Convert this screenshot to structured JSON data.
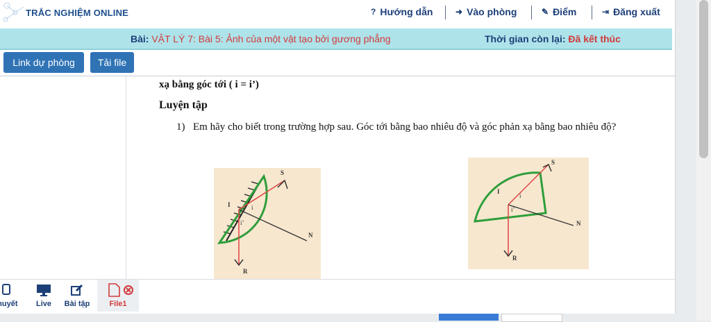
{
  "header": {
    "brand": "TRẮC NGHIỆM ONLINE",
    "nav": [
      {
        "icon": "question-icon",
        "glyph": "?",
        "label": "Hướng dẫn"
      },
      {
        "icon": "login-icon",
        "glyph": "➜",
        "label": "Vào phòng"
      },
      {
        "icon": "edit-icon",
        "glyph": "✎",
        "label": "Điểm"
      },
      {
        "icon": "logout-icon",
        "glyph": "⇥",
        "label": "Đăng xuất"
      }
    ]
  },
  "lesson": {
    "prefix": "Bài:",
    "title": "VẬT LÝ 7: Bài 5: Ảnh của một vật tạo bởi gương phẳng",
    "time_label": "Thời gian còn lại:",
    "time_value": "Đã kết thúc"
  },
  "actions": {
    "backup_link": "Link dự phòng",
    "download": "Tải file"
  },
  "content": {
    "line1": "xạ bằng góc tới ( i = i’)",
    "section": "Luyện tập",
    "question_num": "1)",
    "question_text": "Em hãy cho biết trong trường hợp sau. Góc tới bằng bao nhiêu độ và góc phản xạ bằng bao nhiêu độ?",
    "figure1_labels": {
      "s": "S",
      "i_point": "I",
      "i": "i",
      "i_prime": "i’",
      "n": "N",
      "r": "R"
    },
    "figure2_labels": {
      "s": "S",
      "i_point": "I",
      "i": "i",
      "i_prime": "i’",
      "n": "N",
      "r": "R"
    }
  },
  "bottom_tabs": [
    {
      "label": "thuyết",
      "icon": "tablet-icon"
    },
    {
      "label": "Live",
      "icon": "monitor-icon"
    },
    {
      "label": "Bài tập",
      "icon": "edit-icon"
    },
    {
      "label": "File1",
      "icon": "file-icon",
      "active": true
    }
  ],
  "colors": {
    "accent": "#2f73b5",
    "danger": "#d13a3a",
    "lesson_bar": "#aee3ea",
    "navy": "#1d3f78"
  }
}
